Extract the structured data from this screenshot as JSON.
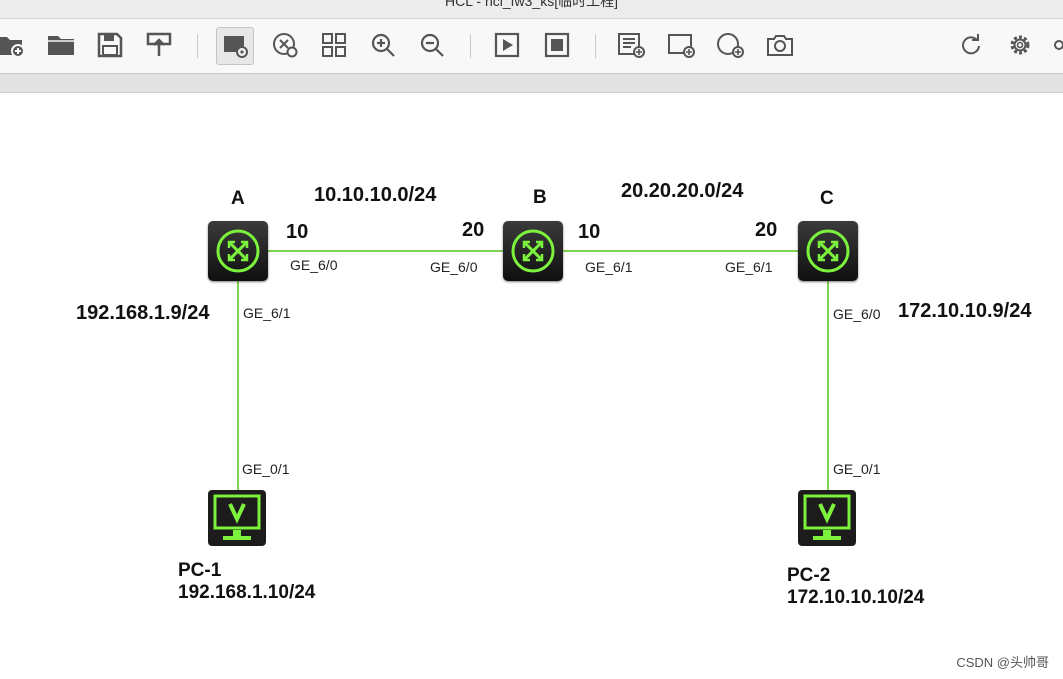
{
  "window": {
    "title": "HCL - hcl_fw3_ks[临时工程]"
  },
  "toolbar": {
    "buttons": [
      {
        "icon": "new-topology-icon"
      },
      {
        "icon": "open-folder-icon"
      },
      {
        "icon": "save-icon"
      },
      {
        "icon": "export-icon"
      },
      {
        "icon": "show-interface-icon"
      },
      {
        "icon": "grid-toggle-icon"
      },
      {
        "icon": "layout-icon"
      },
      {
        "icon": "zoom-in-icon"
      },
      {
        "icon": "zoom-out-icon"
      },
      {
        "icon": "start-all-icon"
      },
      {
        "icon": "stop-all-icon"
      },
      {
        "icon": "add-text-icon"
      },
      {
        "icon": "add-rectangle-icon"
      },
      {
        "icon": "add-ellipse-icon"
      },
      {
        "icon": "screenshot-icon"
      },
      {
        "icon": "refresh-icon"
      },
      {
        "icon": "settings-icon"
      }
    ]
  },
  "topology": {
    "colors": {
      "link": "#7dd34f",
      "device_accent": "#7cf23c",
      "device_body": "#1c1c1c"
    },
    "devices": {
      "A": {
        "name": "A"
      },
      "B": {
        "name": "B"
      },
      "C": {
        "name": "C"
      },
      "pc1": {
        "name": "PC-1",
        "ip": "192.168.1.10/24"
      },
      "pc2": {
        "name": "PC-2",
        "ip": "172.10.10.10/24"
      }
    },
    "networks": {
      "ab": "10.10.10.0/24",
      "bc": "20.20.20.0/24"
    },
    "host_ips": {
      "a_side": "192.168.1.9/24",
      "c_side": "172.10.10.9/24"
    },
    "addr_suffix": {
      "a_ab": "10",
      "b_ab": "20",
      "b_bc": "10",
      "c_bc": "20"
    },
    "ports": {
      "a_to_b": "GE_6/0",
      "b_to_a": "GE_6/0",
      "b_to_c": "GE_6/1",
      "c_to_b": "GE_6/1",
      "a_to_pc1": "GE_6/1",
      "pc1_to_a": "GE_0/1",
      "c_to_pc2": "GE_6/0",
      "pc2_to_c": "GE_0/1"
    }
  },
  "watermark": "CSDN @头帅哥"
}
